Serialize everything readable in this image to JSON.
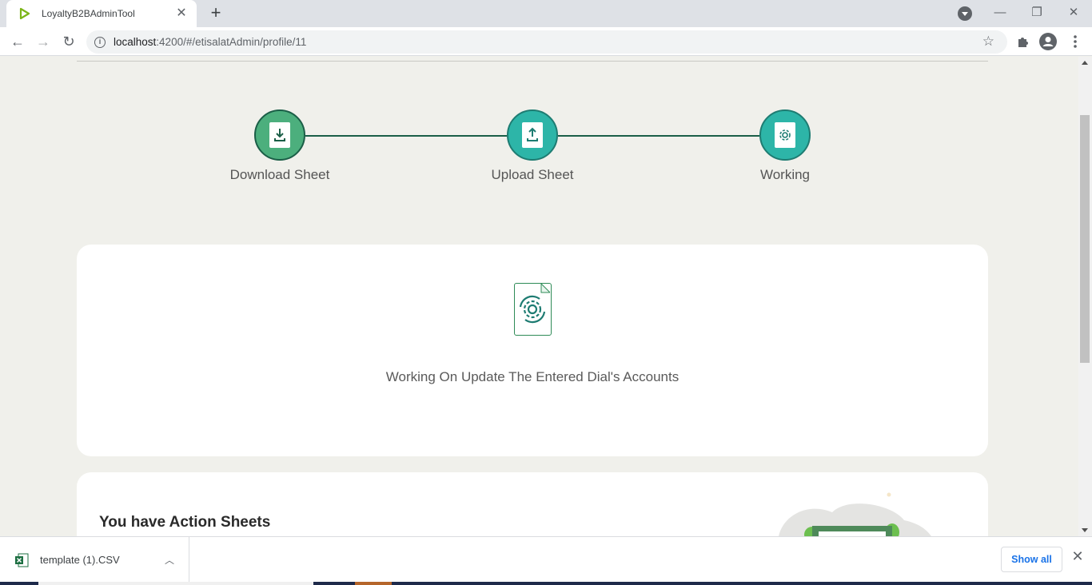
{
  "browser": {
    "tab_title": "LoyaltyB2BAdminTool",
    "url_host": "localhost",
    "url_rest": ":4200/#/etisalatAdmin/profile/11"
  },
  "stepper": {
    "steps": [
      {
        "label": "Download Sheet",
        "state": "completed",
        "icon": "download-icon"
      },
      {
        "label": "Upload Sheet",
        "state": "active",
        "icon": "upload-icon"
      },
      {
        "label": "Working",
        "state": "active",
        "icon": "gear-sync-icon"
      }
    ]
  },
  "status_card": {
    "icon": "gear-sync-document-icon",
    "message": "Working On Update The Entered Dial's Accounts"
  },
  "action_card": {
    "title": "You have Action Sheets"
  },
  "downloads": {
    "file_name": "template (1).CSV",
    "show_all_label": "Show all"
  },
  "colors": {
    "primary_green": "#4caf7d",
    "dark_green": "#1b5e47",
    "teal": "#2db5a8",
    "page_bg": "#f0f0eb"
  }
}
